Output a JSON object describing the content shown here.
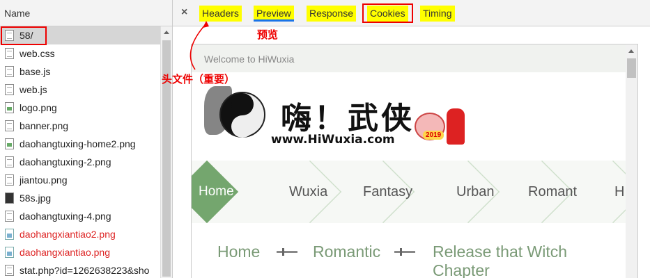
{
  "network": {
    "header": "Name",
    "requests": [
      {
        "name": "58/",
        "icon": "doc",
        "status": "selected"
      },
      {
        "name": "web.css",
        "icon": "doc",
        "status": "ok"
      },
      {
        "name": "base.js",
        "icon": "doc",
        "status": "ok"
      },
      {
        "name": "web.js",
        "icon": "doc",
        "status": "ok"
      },
      {
        "name": "logo.png",
        "icon": "image",
        "status": "ok"
      },
      {
        "name": "banner.png",
        "icon": "doc",
        "status": "ok"
      },
      {
        "name": "daohangtuxing-home2.png",
        "icon": "image",
        "status": "ok"
      },
      {
        "name": "daohangtuxing-2.png",
        "icon": "doc",
        "status": "ok"
      },
      {
        "name": "jiantou.png",
        "icon": "doc",
        "status": "ok"
      },
      {
        "name": "58s.jpg",
        "icon": "image-dark",
        "status": "ok"
      },
      {
        "name": "daohangtuxing-4.png",
        "icon": "doc",
        "status": "ok"
      },
      {
        "name": "daohangxiantiao2.png",
        "icon": "broken-image",
        "status": "error"
      },
      {
        "name": "daohangxiantiao.png",
        "icon": "broken-image",
        "status": "error"
      },
      {
        "name": "stat.php?id=1262638223&sho",
        "icon": "doc",
        "status": "ok"
      }
    ]
  },
  "tabs": {
    "close": "×",
    "items": [
      {
        "label": "Headers"
      },
      {
        "label": "Preview"
      },
      {
        "label": "Response"
      },
      {
        "label": "Cookies"
      },
      {
        "label": "Timing"
      }
    ]
  },
  "annotations": {
    "preview_note": "预览",
    "headers_note": "头文件（重要）"
  },
  "preview": {
    "welcome": "Welcome to HiWuxia",
    "logo_text": "嗨！武侠",
    "site_url": "www.HiWuxia.com",
    "year_badge": "2019",
    "nav": [
      "Home",
      "Wuxia",
      "Fantasy",
      "Urban",
      "Romant",
      "H"
    ],
    "breadcrumb": [
      "Home",
      "Romantic",
      "Release that Witch Chapter"
    ]
  },
  "colors": {
    "tab_highlight": "#ffff00",
    "annotation_red": "#ee0000",
    "nav_green": "#74a66e",
    "breadcrumb_green": "#7a9a76"
  }
}
